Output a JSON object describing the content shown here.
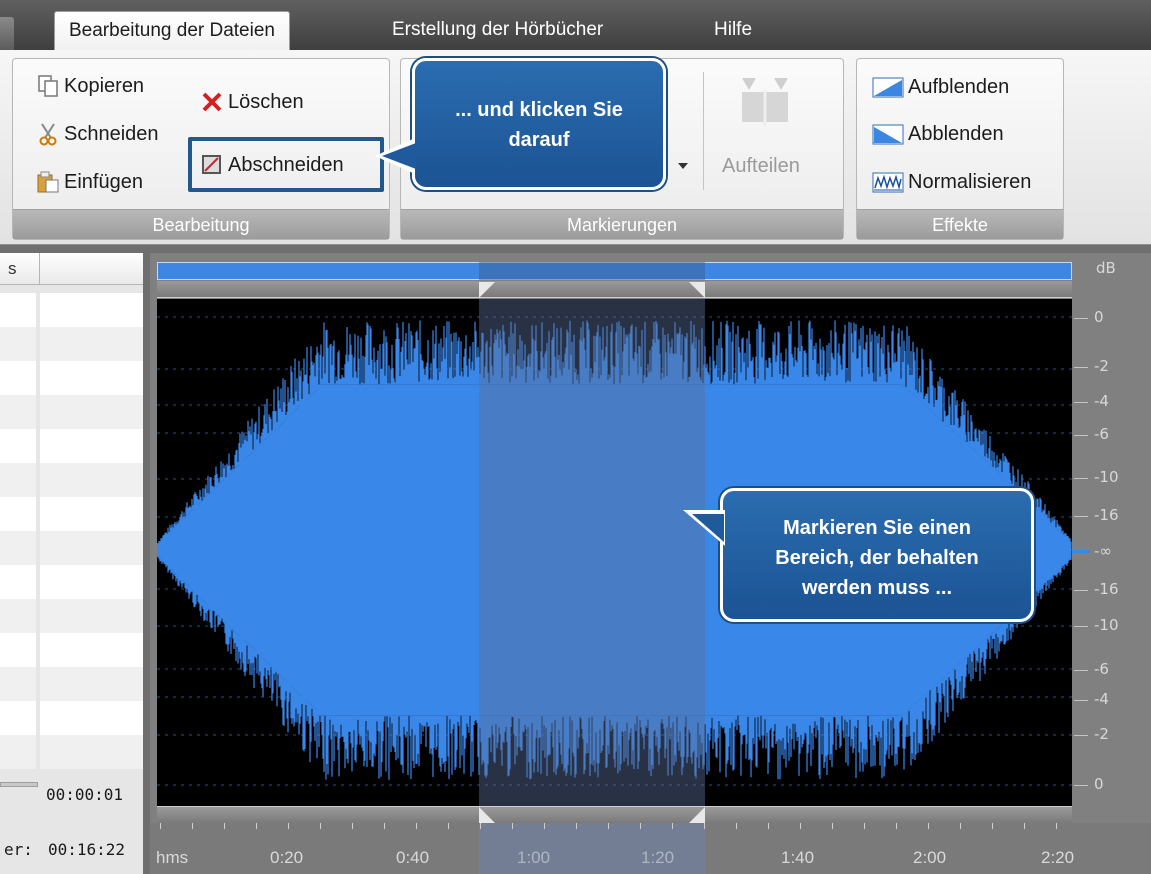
{
  "tabs": [
    {
      "label": "Bearbeitung der Dateien",
      "active": true
    },
    {
      "label": "Erstellung der Hörbücher",
      "active": false
    },
    {
      "label": "Hilfe",
      "active": false
    }
  ],
  "ribbon": {
    "bearbeitung": {
      "label": "Bearbeitung",
      "kopieren": "Kopieren",
      "schneiden": "Schneiden",
      "einfuegen": "Einfügen",
      "loeschen": "Löschen",
      "abschneiden": "Abschneiden"
    },
    "markierungen": {
      "label": "Markierungen",
      "aufteilen": "Aufteilen"
    },
    "effekte": {
      "label": "Effekte",
      "aufblenden": "Aufblenden",
      "abblenden": "Abblenden",
      "normalisieren": "Normalisieren"
    }
  },
  "callouts": {
    "top_line1": "... und klicken Sie",
    "top_line2": "darauf",
    "mid_line1": "Markieren Sie einen",
    "mid_line2": "Bereich, der behalten",
    "mid_line3": "werden muss ..."
  },
  "left_panel": {
    "header": "s",
    "selection_time": "00:00:01",
    "total_label": "er:",
    "total_time": "00:16:22"
  },
  "db_scale": {
    "unit": "dB",
    "labels": [
      "0",
      "-2",
      "-4",
      "-6",
      "-10",
      "-16",
      "-∞",
      "-16",
      "-10",
      "-6",
      "-4",
      "-2",
      "0"
    ]
  },
  "timeline": {
    "unit": "hms",
    "labels": [
      "0:20",
      "0:40",
      "1:00",
      "1:20",
      "1:40",
      "2:00",
      "2:20"
    ]
  },
  "colors": {
    "waveform": "#3a87ea",
    "callout": "#1f5a9c",
    "highlight": "#22598a"
  }
}
